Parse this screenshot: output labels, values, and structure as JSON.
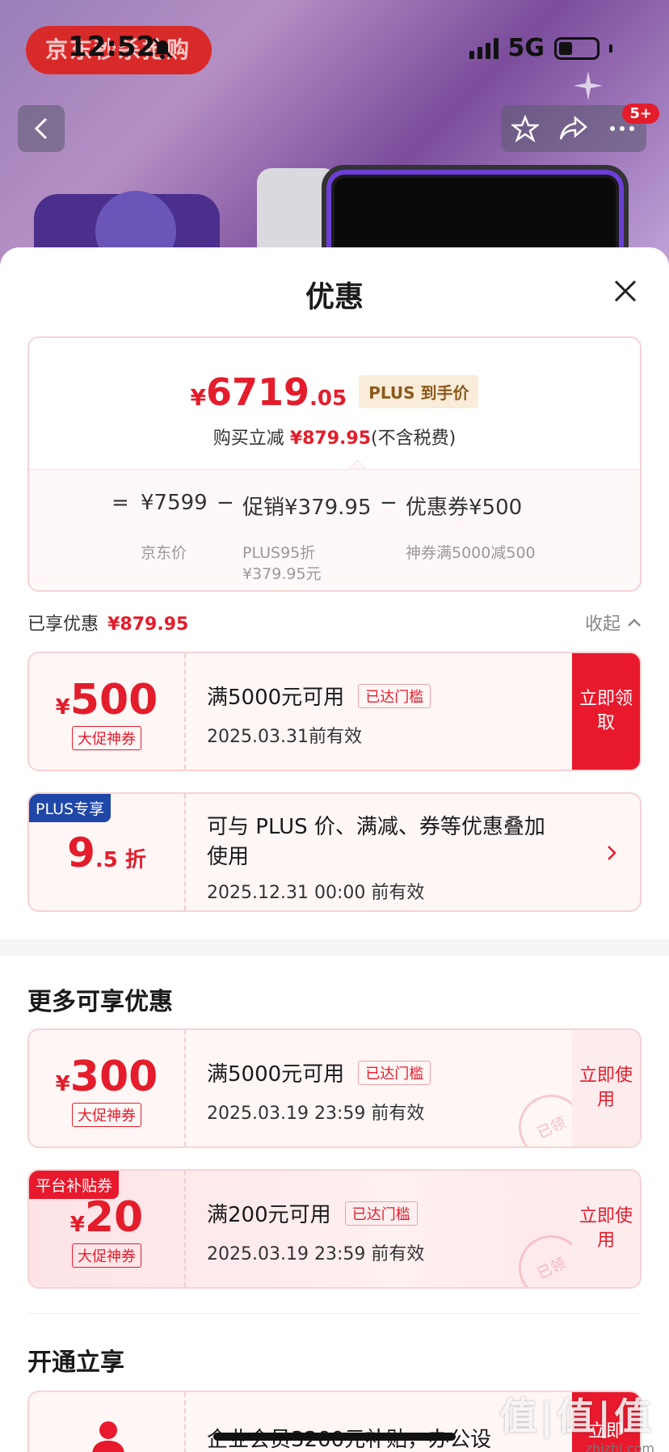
{
  "status_bar": {
    "time": "12:52",
    "network": "5G"
  },
  "background": {
    "brand": "京东秒杀抢购",
    "notification_badge": "5+"
  },
  "sheet": {
    "title": "优惠",
    "price_card": {
      "currency": "¥",
      "price_int": "6719",
      "price_dec": ".05",
      "plus_tag": "PLUS 到手价",
      "reduce_prefix": "购买立减",
      "reduce_value": "¥879.95",
      "reduce_suffix": "(不含税费)",
      "formula": {
        "eq": "=",
        "base": "¥7599",
        "minus1": "−",
        "promo": "促销¥379.95",
        "minus2": "−",
        "coupon": "优惠券¥500",
        "base_label": "京东价",
        "promo_label_1": "PLUS95折",
        "promo_label_2": "¥379.95元",
        "coupon_label": "神券满5000减500"
      }
    },
    "enjoyed": {
      "label": "已享优惠",
      "value": "¥879.95",
      "collapse": "收起"
    },
    "coupons_enjoyed": [
      {
        "currency": "¥",
        "amount": "500",
        "tag": "大促神券",
        "condition": "满5000元可用",
        "reach": "已达门槛",
        "date": "2025.03.31前有效",
        "cta": "立即领取"
      }
    ],
    "plus_offer": {
      "badge": "PLUS专享",
      "big": "9",
      "small": ".5 折",
      "line1": "可与 PLUS 价、满减、券等优惠叠加",
      "line2": "使用",
      "date": "2025.12.31 00:00 前有效"
    },
    "more_title": "更多可享优惠",
    "more_coupons": [
      {
        "currency": "¥",
        "amount": "300",
        "tag": "大促神券",
        "condition": "满5000元可用",
        "reach": "已达门槛",
        "date": "2025.03.19 23:59 前有效",
        "cta": "立即使用",
        "stamp": "已领"
      },
      {
        "badge": "平台补贴券",
        "currency": "¥",
        "amount": "20",
        "tag": "大促神券",
        "condition": "满200元可用",
        "reach": "已达门槛",
        "date": "2025.03.19 23:59 前有效",
        "cta": "立即使用",
        "stamp": "已领"
      }
    ],
    "open_title": "开通立享",
    "member": {
      "text": "企业会员3200元补贴，办公设",
      "cta": "立即"
    }
  },
  "watermark": {
    "big": "值|值|值",
    "small": "zhizhi.com"
  },
  "colors": {
    "accent": "#e31d2b",
    "plus_blue": "#1f47a8",
    "plus_gold": "#8a5a1e"
  },
  "icons": [
    "bell-off-icon",
    "signal-icon",
    "battery-icon",
    "back-icon",
    "star-icon",
    "share-icon",
    "more-icon",
    "close-icon",
    "chevron-up-icon",
    "chevron-right-icon",
    "user-icon",
    "sparkle-icon"
  ]
}
